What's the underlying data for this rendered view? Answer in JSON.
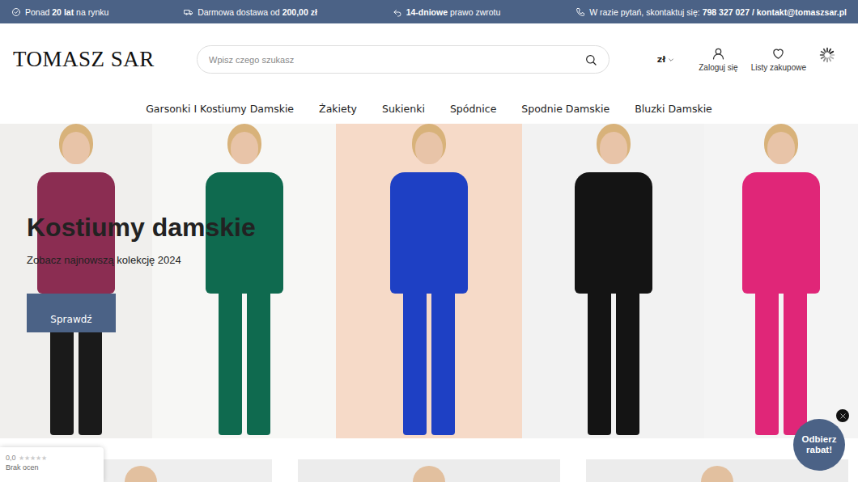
{
  "topbar": {
    "items": [
      {
        "parts": [
          {
            "text": "Ponad ",
            "bold": false
          },
          {
            "text": "20 lat",
            "bold": true
          },
          {
            "text": " na rynku",
            "bold": false
          }
        ]
      },
      {
        "parts": [
          {
            "text": "Darmowa dostawa od ",
            "bold": false
          },
          {
            "text": "200,00 zł",
            "bold": true
          }
        ]
      },
      {
        "parts": [
          {
            "text": "14-dniowe",
            "bold": true
          },
          {
            "text": " prawo zwrotu",
            "bold": false
          }
        ]
      },
      {
        "parts": [
          {
            "text": "W razie pytań, skontaktuj się: ",
            "bold": false
          },
          {
            "text": "798 327 027 / kontakt@tomaszsar.pl",
            "bold": true
          }
        ]
      }
    ]
  },
  "header": {
    "logo": "TOMASZ SAR",
    "search": {
      "placeholder": "Wpisz czego szukasz"
    },
    "currency": "zł",
    "account": "Zaloguj się",
    "wishlist": "Listy zakupowe"
  },
  "nav": [
    "Garsonki I Kostiumy Damskie",
    "Żakiety",
    "Sukienki",
    "Spódnice",
    "Spodnie Damskie",
    "Bluzki Damskie"
  ],
  "hero": {
    "title": "Kostiumy damskie",
    "subtitle": "Zobacz najnowszą kolekcję 2024",
    "button": "Sprawdź"
  },
  "rating_widget": {
    "score": "0,0",
    "stars": 0,
    "label": "Brak ocen"
  },
  "promo": {
    "label": "Odbierz rabat!"
  }
}
